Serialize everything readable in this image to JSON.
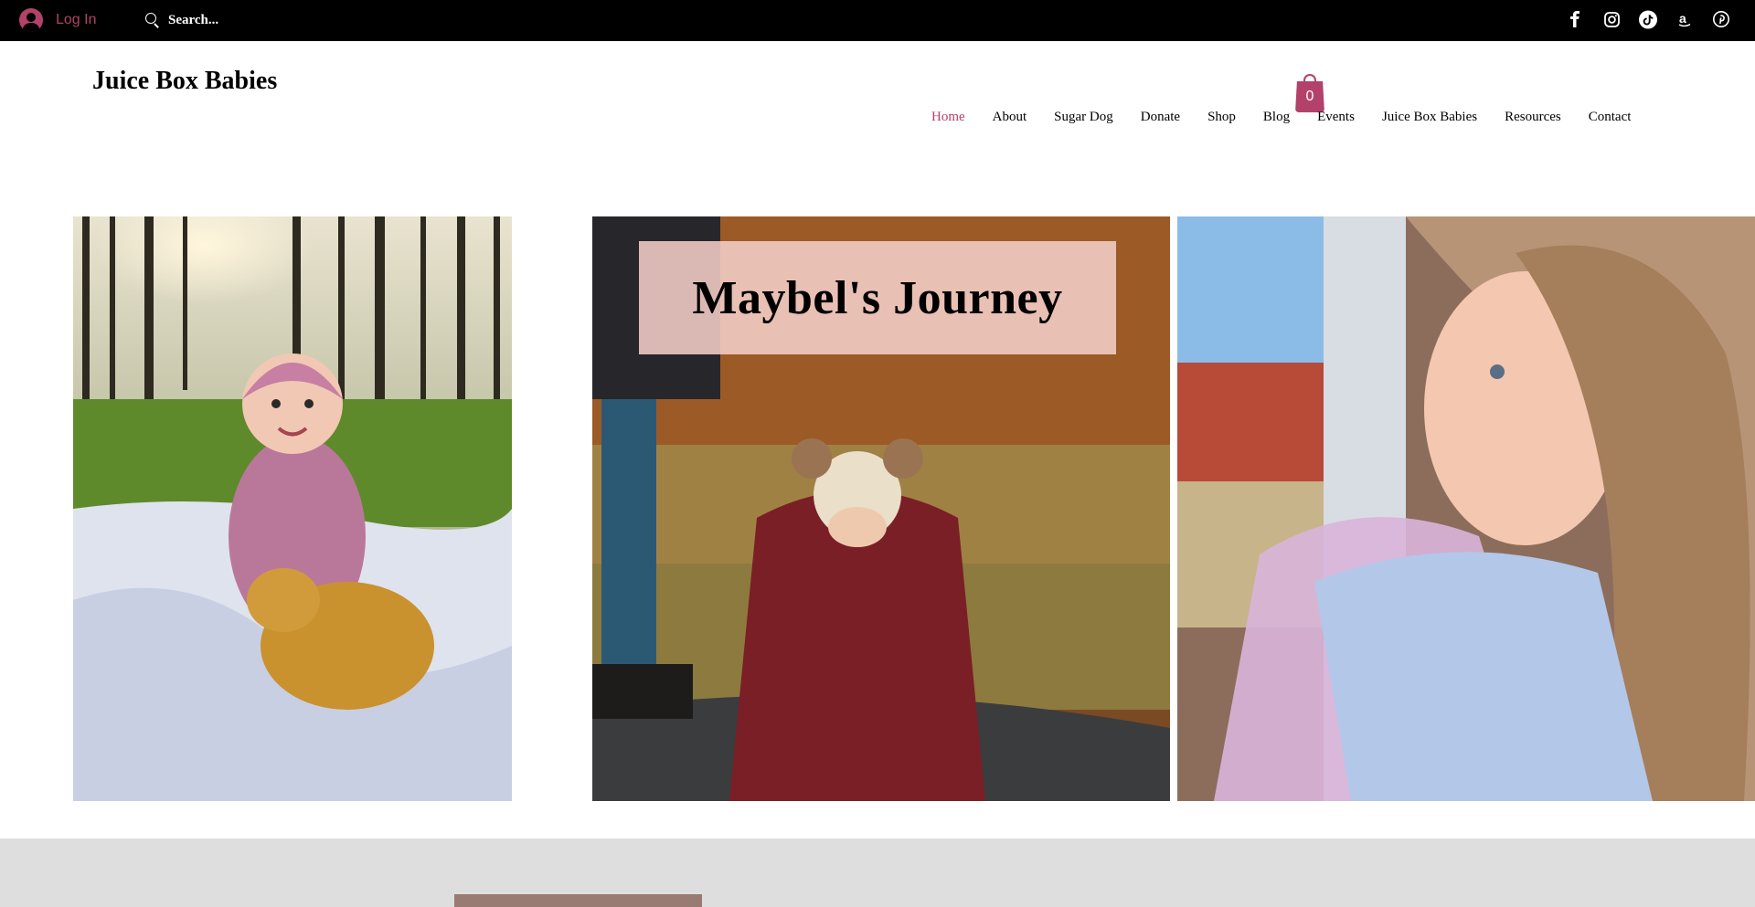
{
  "topbar": {
    "login_label": "Log In",
    "search_placeholder": "Search...",
    "social_icons": [
      "facebook-icon",
      "instagram-icon",
      "tiktok-icon",
      "amazon-icon",
      "pinterest-icon"
    ]
  },
  "header": {
    "brand": "Juice Box Babies",
    "cart_count": "0"
  },
  "nav": {
    "items": [
      {
        "label": "Home",
        "active": true
      },
      {
        "label": "About"
      },
      {
        "label": "Sugar Dog"
      },
      {
        "label": "Donate"
      },
      {
        "label": "Shop"
      },
      {
        "label": "Blog"
      },
      {
        "label": "Events"
      },
      {
        "label": "Juice Box Babies"
      },
      {
        "label": "Resources"
      },
      {
        "label": "Contact"
      }
    ]
  },
  "hero": {
    "title": "Maybel's Journey"
  },
  "colors": {
    "accent": "#b2426a",
    "topbar_bg": "#000000",
    "title_box_bg": "#f4cec8",
    "band_bg": "#dedede"
  }
}
